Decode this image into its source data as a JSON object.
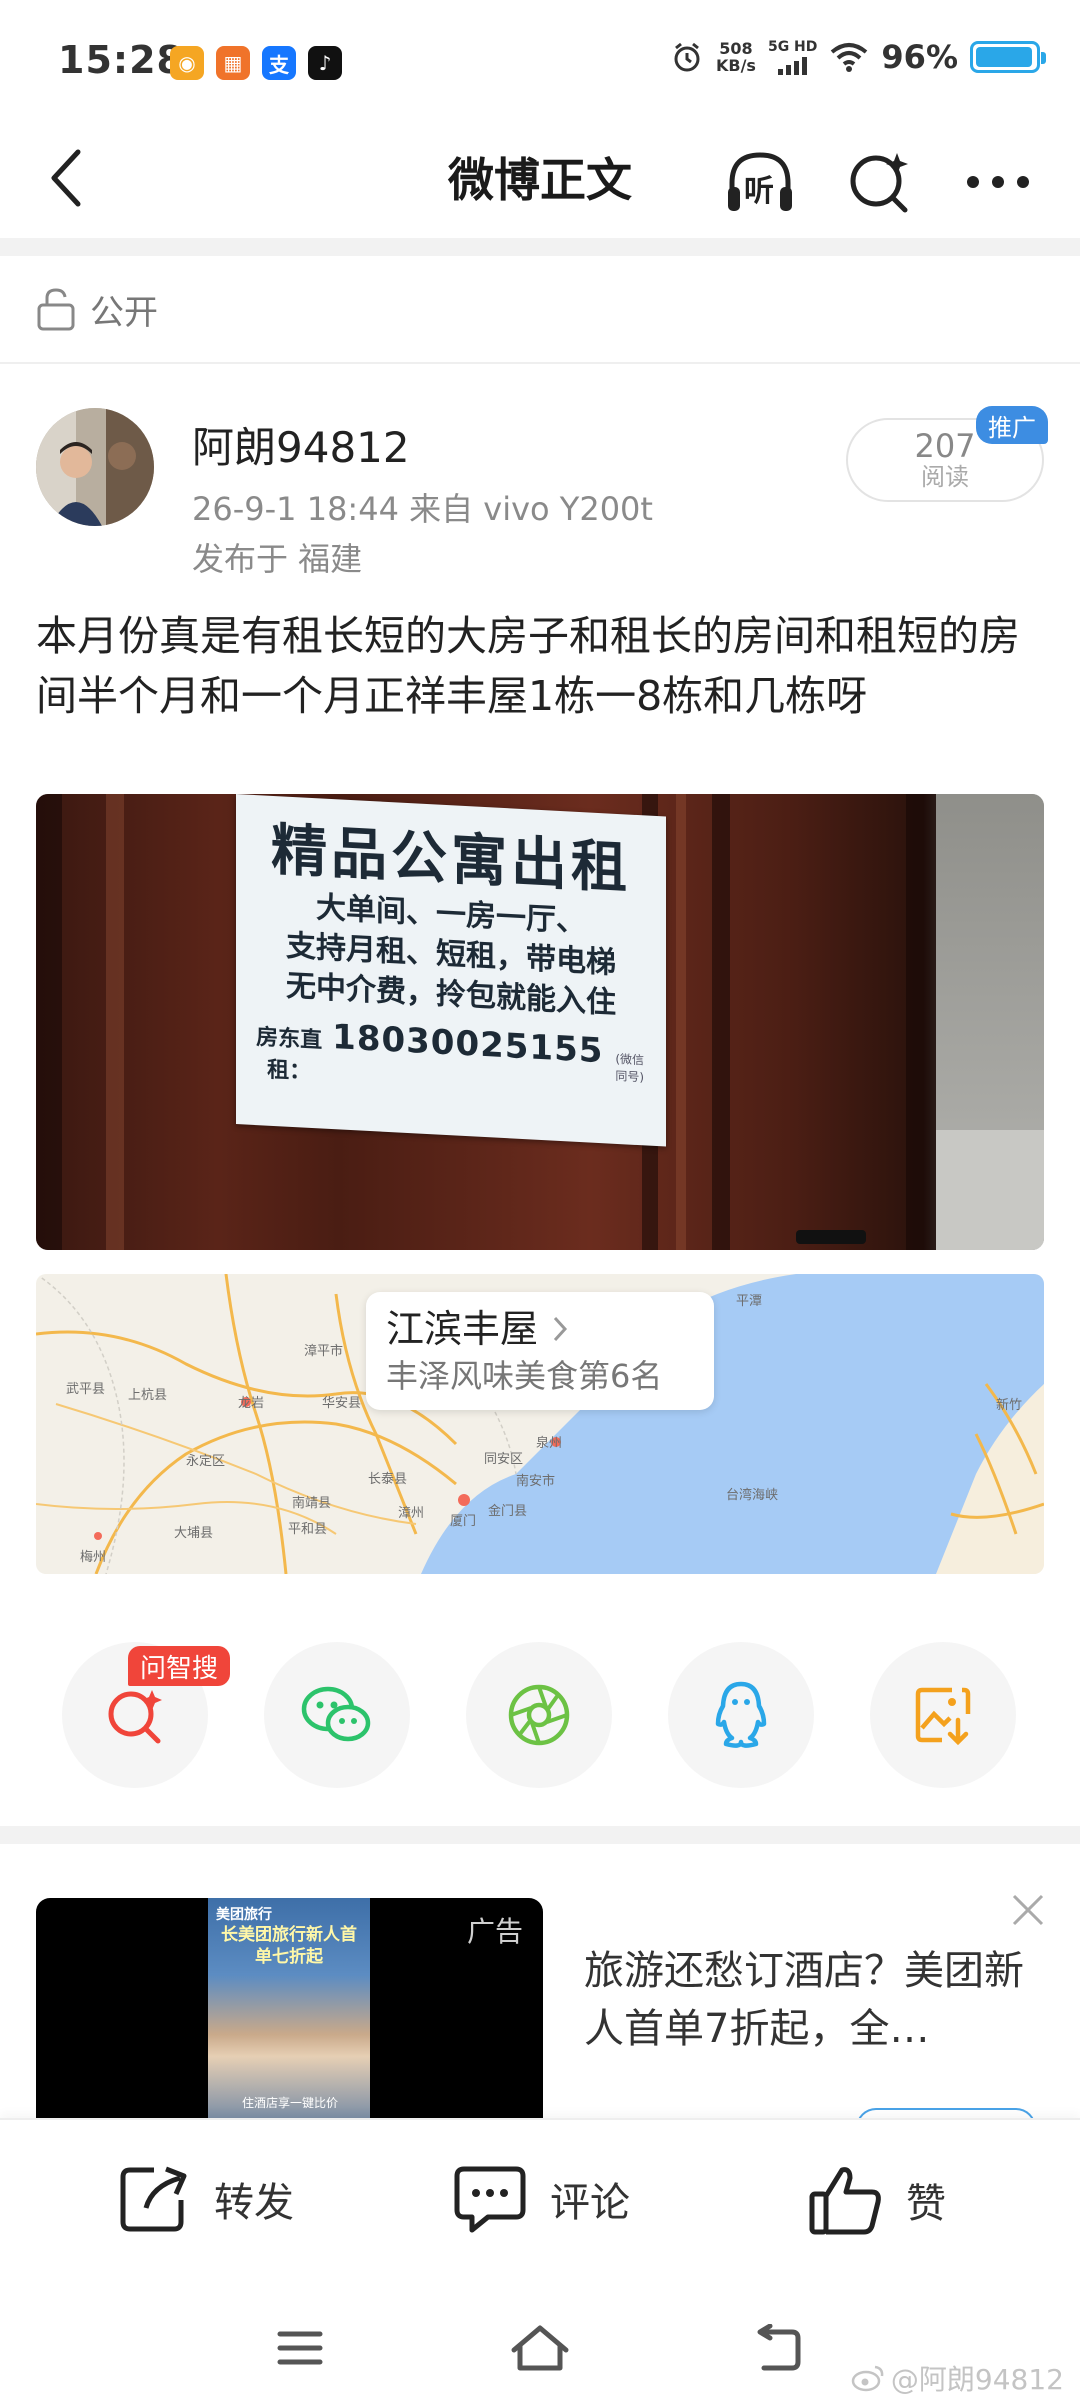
{
  "status_bar": {
    "time": "15:28",
    "net_speed_value": "508",
    "net_speed_unit": "KB/s",
    "net_type": "5G HD",
    "battery_percent_text": "96%",
    "battery_level": 0.96,
    "apps": [
      {
        "name": "weibo-app-icon",
        "glyph": "◉",
        "color": "#f5a623"
      },
      {
        "name": "grid-app-icon",
        "glyph": "▦",
        "color": "#f0732a"
      },
      {
        "name": "alipay-app-icon",
        "glyph": "支",
        "color": "#1677ff"
      },
      {
        "name": "tiktok-app-icon",
        "glyph": "♪",
        "color": "#111111"
      }
    ]
  },
  "nav": {
    "title": "微博正文",
    "listen_label": "听"
  },
  "visibility": {
    "label": "公开"
  },
  "post": {
    "author": "阿朗94812",
    "meta": "26-9-1 18:44  来自 vivo Y200t",
    "location": "发布于 福建",
    "read_count": "207",
    "read_label": "阅读",
    "promo_badge": "推广",
    "text": "本月份真是有租长短的大房子和租长的房间和租短的房间半个月和一个月正祥丰屋1栋一8栋和几栋呀"
  },
  "photo_sign": {
    "title": "精品公寓出租",
    "line1": "大单间、一房一厅、",
    "line2": "支持月租、短租，带电梯",
    "line3": "无中介费，拎包就能入住",
    "phone_label": "房东直租：",
    "phone": "18030025155",
    "phone_note": "(微信同号)"
  },
  "map": {
    "place": "江滨丰屋",
    "desc": "丰泽风味美食第6名",
    "labels": [
      "武平县",
      "上杭县",
      "龙岩",
      "永定区",
      "华安县",
      "漳平市",
      "长泰县",
      "南靖县",
      "平和县",
      "漳州",
      "厦门",
      "金门县",
      "泉州",
      "同安区",
      "南安市",
      "平潭",
      "台湾海峡",
      "新竹",
      "梅州",
      "大埔县"
    ]
  },
  "share": {
    "ai_badge": "问智搜",
    "buttons": [
      "ai-search",
      "wechat",
      "moments",
      "qq",
      "save-image"
    ]
  },
  "ad": {
    "tag": "广告",
    "text": "旅游还愁订酒店？美团新人首单7折起，全…",
    "inner_brand": "美团旅行",
    "inner_title": "长美团旅行新人首单七折起",
    "inner_cta": "住酒店享一键比价"
  },
  "actions": {
    "repost": "转发",
    "comment": "评论",
    "like": "赞"
  },
  "watermark": "@阿朗94812",
  "colors": {
    "accent_blue": "#3d8de2",
    "badge_red": "#f0453a",
    "wechat_green": "#2cc36b",
    "qq_blue": "#2aa7e8",
    "save_orange": "#f4a11d"
  }
}
